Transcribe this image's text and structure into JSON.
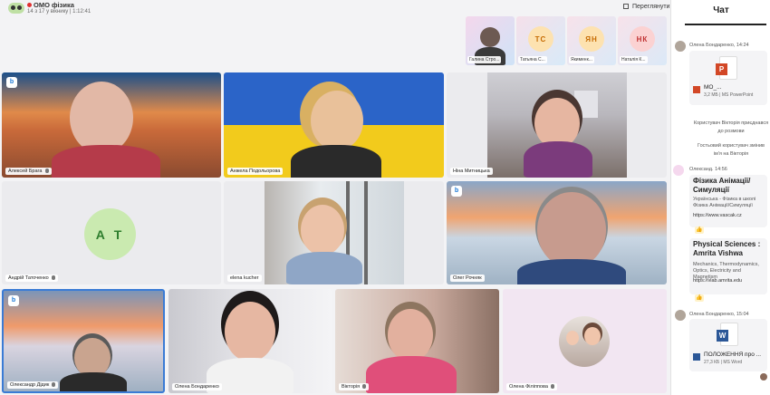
{
  "header": {
    "title": "ОМО фізика",
    "subtitle": "14 з 17 у вікнику | 1:12:41",
    "view_button": "Переглянути"
  },
  "thumbnails": [
    {
      "name": "Галина Стро...",
      "initials": ""
    },
    {
      "name": "Татьяна С...",
      "initials": "ТС"
    },
    {
      "name": "Якименк...",
      "initials": "ЯН"
    },
    {
      "name": "Наталія К...",
      "initials": "НК"
    }
  ],
  "participants": [
    {
      "name": "Алексей Брага"
    },
    {
      "name": "Анжела Подольорова"
    },
    {
      "name": "Ніна Митницька"
    },
    {
      "name": "Андрій Таточенко",
      "initials": "А Т"
    },
    {
      "name": "elena kucher"
    },
    {
      "name": "Олег Рочняк"
    },
    {
      "name": "Олександр Дідик"
    },
    {
      "name": "Олена Бондаренко"
    },
    {
      "name": "Вікторія"
    },
    {
      "name": "Олена Філіппова"
    }
  ],
  "chat": {
    "title": "Чат",
    "messages": [
      {
        "sender": "Олена Бондаренко, 14:24",
        "file_name": "МО_...",
        "file_meta": "3,2 МБ | MS PowerPoint"
      },
      {
        "system": "Користувач Вікторія приєднався до розмови"
      },
      {
        "system": "Гостьовий користувач змінив ім'я на Вікторія"
      },
      {
        "sender": "Олександ. 14:56",
        "link_title": "Фізика Анімації/Симуляції",
        "link_desc": "Українська - Фізика в школі Фізика Анімації/Симуляції",
        "link_url": "https://www.vascak.cz",
        "link2_title": "Physical Sciences : Amrita Vishwa",
        "link2_desc": "Mechanics, Thermodynamics, Optics, Electricity and Magnetism",
        "link2_url": "https://vlab.amrita.edu"
      },
      {
        "sender": "Олена Бондаренко, 15:04",
        "file_name": "ПОЛОЖЕННЯ про ...",
        "file_meta": "27,3 КБ | MS Word"
      }
    ]
  },
  "colors": {
    "ppt": "#d24726",
    "word": "#2b5797",
    "accent": "#1e7bd7"
  }
}
